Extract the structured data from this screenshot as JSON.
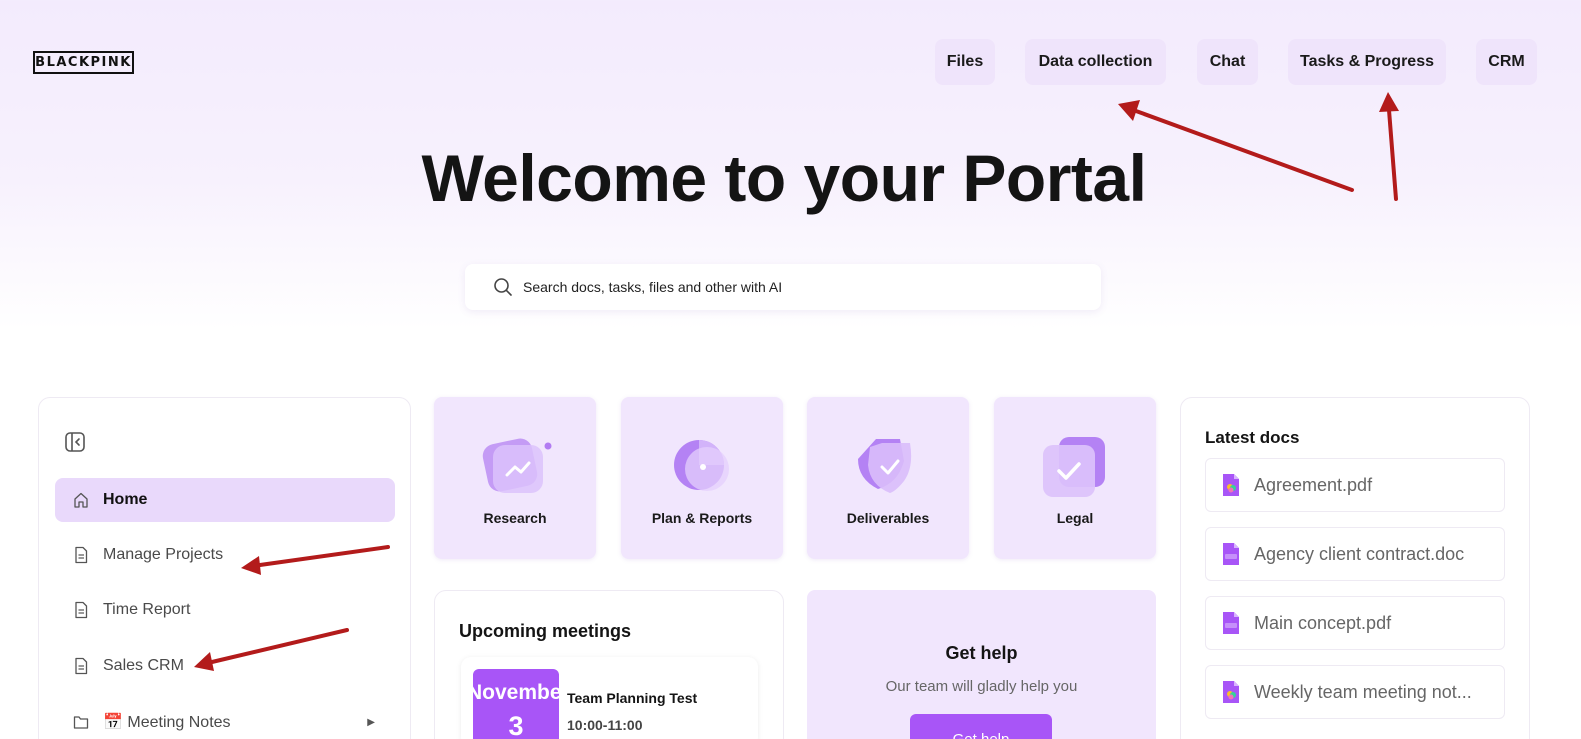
{
  "header": {
    "logo_text": "BLACKPINK",
    "nav": [
      {
        "label": "Files"
      },
      {
        "label": "Data collection"
      },
      {
        "label": "Chat"
      },
      {
        "label": "Tasks & Progress"
      },
      {
        "label": "CRM"
      }
    ]
  },
  "hero": {
    "title": "Welcome to your Portal"
  },
  "search": {
    "placeholder": "Search docs, tasks, files and other with AI",
    "icon": "search-icon"
  },
  "sidebar": {
    "items": [
      {
        "label": "Home",
        "icon": "home-icon",
        "active": true
      },
      {
        "label": "Manage Projects",
        "icon": "document-icon"
      },
      {
        "label": "Time Report",
        "icon": "document-icon"
      },
      {
        "label": "Sales CRM",
        "icon": "document-icon"
      },
      {
        "label": "📅 Meeting Notes",
        "icon": "folder-icon"
      }
    ]
  },
  "tiles": [
    {
      "label": "Research",
      "icon": "chart-icon"
    },
    {
      "label": "Plan & Reports",
      "icon": "pie-chart-icon"
    },
    {
      "label": "Deliverables",
      "icon": "shield-check-icon"
    },
    {
      "label": "Legal",
      "icon": "checkmark-card-icon"
    }
  ],
  "meetings": {
    "title": "Upcoming meetings",
    "items": [
      {
        "month": "November",
        "day": "3",
        "title": "Team Planning Test",
        "time": "10:00-11:00"
      }
    ]
  },
  "help": {
    "title": "Get help",
    "subtitle": "Our team will gladly help you",
    "button": "Get help"
  },
  "docs": {
    "title": "Latest docs",
    "items": [
      {
        "name": "Agreement.pdf"
      },
      {
        "name": "Agency client contract.doc"
      },
      {
        "name": "Main concept.pdf"
      },
      {
        "name": "Weekly team meeting not..."
      }
    ]
  },
  "colors": {
    "accent": "#a855f7",
    "tile_bg": "#f1e6fd",
    "active_nav": "#e9d9fb",
    "annotation_arrow": "#b31b1b"
  }
}
